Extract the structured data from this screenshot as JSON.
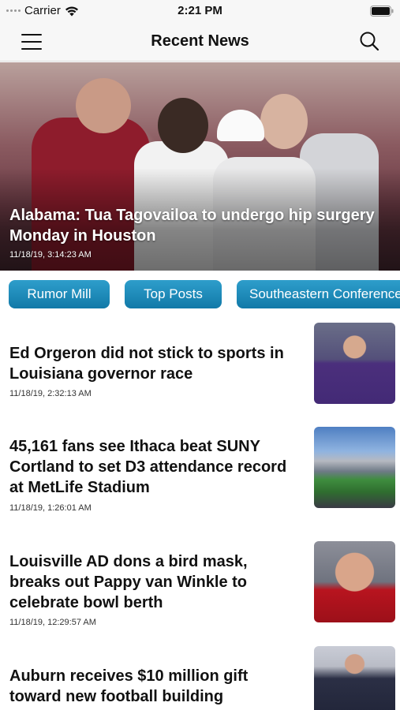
{
  "status_bar": {
    "carrier": "Carrier",
    "time": "2:21 PM"
  },
  "nav": {
    "title": "Recent News",
    "menu_icon": "menu-icon",
    "search_icon": "search-icon"
  },
  "hero": {
    "title": "Alabama: Tua Tagovailoa to undergo hip surgery Monday in Houston",
    "date": "11/18/19, 3:14:23 AM"
  },
  "categories": [
    "Rumor Mill",
    "Top Posts",
    "Southeastern Conference"
  ],
  "articles": [
    {
      "title": "Ed Orgeron did not stick to sports in Louisiana governor race",
      "date": "11/18/19, 2:32:13 AM"
    },
    {
      "title": "45,161 fans see Ithaca beat SUNY Cortland to set D3 attendance record at MetLife Stadium",
      "date": "11/18/19, 1:26:01 AM"
    },
    {
      "title": "Louisville AD dons a bird mask, breaks out Pappy van Winkle to celebrate bowl berth",
      "date": "11/18/19, 12:29:57 AM"
    },
    {
      "title": "Auburn receives $10 million gift toward new football building",
      "date": ""
    }
  ],
  "colors": {
    "chip": "#1a8bbd",
    "nav_background": "#f7f7f7",
    "text": "#111111"
  }
}
